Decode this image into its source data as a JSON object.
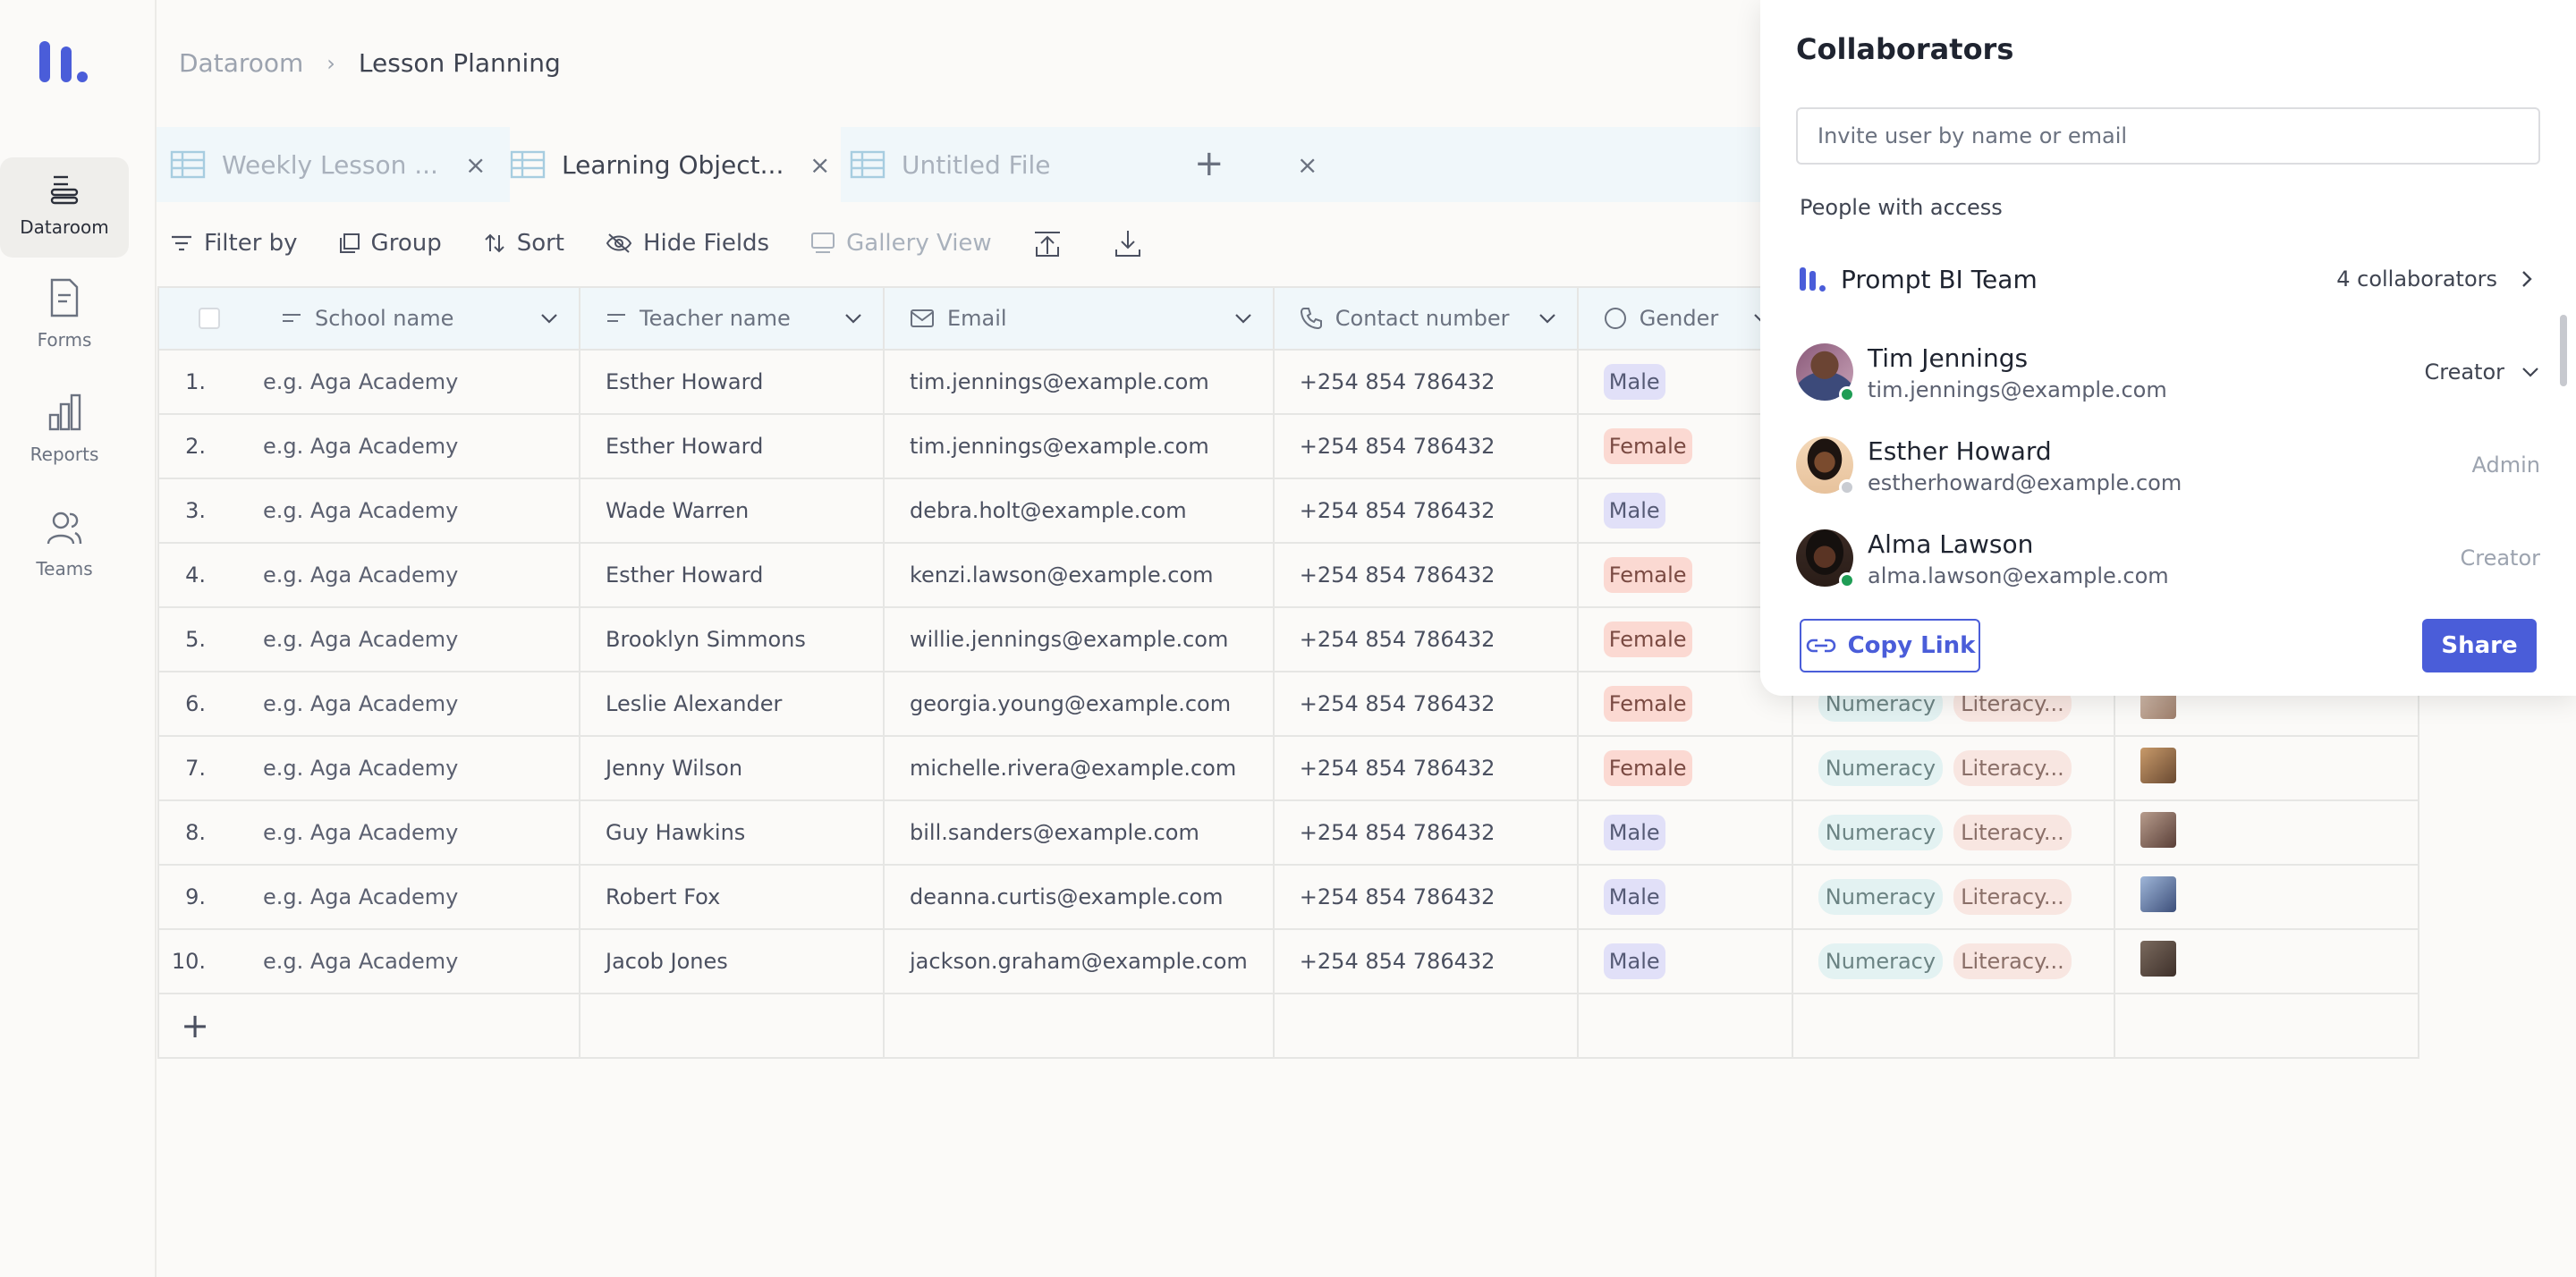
{
  "sidebar": {
    "items": [
      {
        "label": "Dataroom",
        "icon": "dataroom-icon",
        "active": true
      },
      {
        "label": "Forms",
        "icon": "forms-icon"
      },
      {
        "label": "Reports",
        "icon": "reports-icon"
      },
      {
        "label": "Teams",
        "icon": "teams-icon"
      }
    ]
  },
  "breadcrumb": {
    "root": "Dataroom",
    "current": "Lesson Planning"
  },
  "tabs": [
    {
      "label": "Weekly Lesson ..."
    },
    {
      "label": "Learning Object..."
    },
    {
      "label": "Untitled File"
    }
  ],
  "toolbar": {
    "filter": "Filter by",
    "group": "Group",
    "sort": "Sort",
    "hide": "Hide Fields",
    "view": "Gallery View"
  },
  "table": {
    "columns": [
      "School name",
      "Teacher name",
      "Email",
      "Contact number",
      "Gender"
    ],
    "rows": [
      {
        "n": "1.",
        "school": "e.g. Aga Academy",
        "teacher": "Esther Howard",
        "email": "tim.jennings@example.com",
        "phone": "+254 854 786432",
        "gender": "Male"
      },
      {
        "n": "2.",
        "school": "e.g. Aga Academy",
        "teacher": "Esther Howard",
        "email": "tim.jennings@example.com",
        "phone": "+254 854 786432",
        "gender": "Female"
      },
      {
        "n": "3.",
        "school": "e.g. Aga Academy",
        "teacher": "Wade Warren",
        "email": "debra.holt@example.com",
        "phone": "+254 854 786432",
        "gender": "Male"
      },
      {
        "n": "4.",
        "school": "e.g. Aga Academy",
        "teacher": "Esther Howard",
        "email": "kenzi.lawson@example.com",
        "phone": "+254 854 786432",
        "gender": "Female"
      },
      {
        "n": "5.",
        "school": "e.g. Aga Academy",
        "teacher": "Brooklyn Simmons",
        "email": "willie.jennings@example.com",
        "phone": "+254 854 786432",
        "gender": "Female"
      },
      {
        "n": "6.",
        "school": "e.g. Aga Academy",
        "teacher": "Leslie Alexander",
        "email": "georgia.young@example.com",
        "phone": "+254 854 786432",
        "gender": "Female",
        "tags": [
          "Numeracy",
          "Literacy..."
        ]
      },
      {
        "n": "7.",
        "school": "e.g. Aga Academy",
        "teacher": "Jenny Wilson",
        "email": "michelle.rivera@example.com",
        "phone": "+254 854 786432",
        "gender": "Female",
        "tags": [
          "Numeracy",
          "Literacy..."
        ]
      },
      {
        "n": "8.",
        "school": "e.g. Aga Academy",
        "teacher": "Guy Hawkins",
        "email": "bill.sanders@example.com",
        "phone": "+254 854 786432",
        "gender": "Male",
        "tags": [
          "Numeracy",
          "Literacy..."
        ]
      },
      {
        "n": "9.",
        "school": "e.g. Aga Academy",
        "teacher": "Robert Fox",
        "email": "deanna.curtis@example.com",
        "phone": "+254 854 786432",
        "gender": "Male",
        "tags": [
          "Numeracy",
          "Literacy..."
        ]
      },
      {
        "n": "10.",
        "school": "e.g. Aga Academy",
        "teacher": "Jacob Jones",
        "email": "jackson.graham@example.com",
        "phone": "+254 854 786432",
        "gender": "Male",
        "tags": [
          "Numeracy",
          "Literacy..."
        ]
      }
    ]
  },
  "collaborators": {
    "title": "Collaborators",
    "invite_placeholder": "Invite user by name or email",
    "access_label": "People with access",
    "team": {
      "name": "Prompt BI Team",
      "count": "4 collaborators"
    },
    "people": [
      {
        "name": "Tim Jennings",
        "email": "tim.jennings@example.com",
        "role": "Creator",
        "online": true
      },
      {
        "name": "Esther Howard",
        "email": "estherhoward@example.com",
        "role": "Admin",
        "online": false
      },
      {
        "name": "Alma Lawson",
        "email": "alma.lawson@example.com",
        "role": "Creator",
        "online": true
      }
    ],
    "copy_link": "Copy Link",
    "share": "Share"
  },
  "colors": {
    "accent": "#4a5dd9",
    "online": "#1f9d55"
  }
}
